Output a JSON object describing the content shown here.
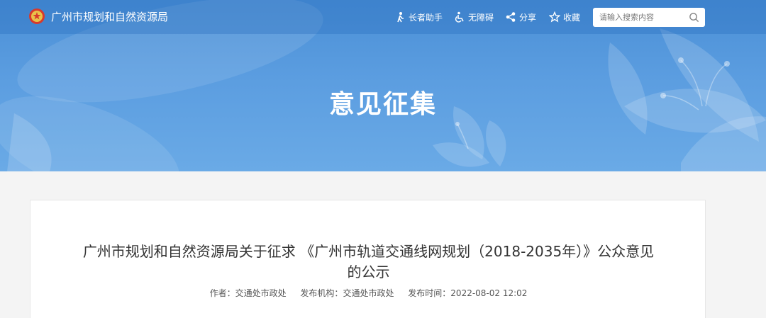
{
  "header": {
    "site_title": "广州市规划和自然资源局",
    "links": [
      {
        "label": "长者助手",
        "icon": "elder-assistant-icon"
      },
      {
        "label": "无障碍",
        "icon": "accessibility-icon"
      },
      {
        "label": "分享",
        "icon": "share-icon"
      },
      {
        "label": "收藏",
        "icon": "star-icon"
      }
    ],
    "search": {
      "placeholder": "请输入搜索内容",
      "value": ""
    }
  },
  "hero": {
    "title": "意见征集"
  },
  "article": {
    "title": "广州市规划和自然资源局关于征求 《广州市轨道交通线网规划（2018-2035年）》公众意见的公示",
    "meta": {
      "author_label": "作者：",
      "author": "交通处市政处",
      "publisher_label": "发布机构：",
      "publisher": "交通处市政处",
      "time_label": "发布时间：",
      "time": "2022-08-02 12:02"
    }
  },
  "colors": {
    "banner": "#5b9de0",
    "background": "#f4f4f4",
    "card": "#ffffff"
  }
}
